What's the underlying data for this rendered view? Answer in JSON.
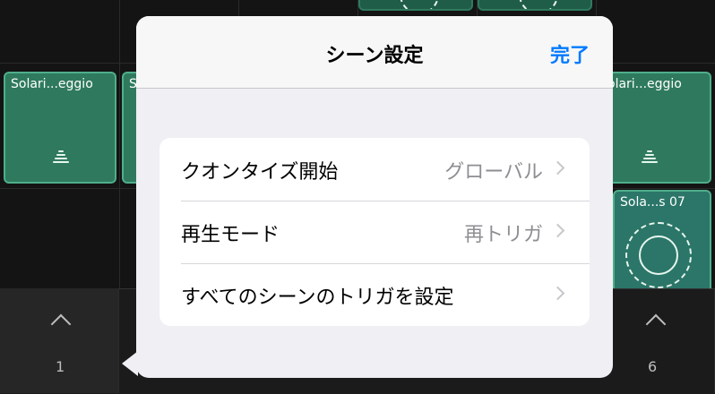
{
  "clips": {
    "clip1": "Solari...eggio",
    "clip2": "S",
    "clip3": "olari...eggio",
    "clip4": "Sola...s 07"
  },
  "scenes": {
    "scene1": "1",
    "scene6": "6"
  },
  "popover": {
    "title": "シーン設定",
    "done": "完了",
    "rows": [
      {
        "label": "クオンタイズ開始",
        "value": "グローバル"
      },
      {
        "label": "再生モード",
        "value": "再トリガ"
      },
      {
        "label": "すべてのシーンのトリガを設定",
        "value": ""
      }
    ]
  },
  "colors": {
    "clip_fill": "#2f7a5e",
    "clip_border": "#4fae8b",
    "accent": "#007aff"
  }
}
